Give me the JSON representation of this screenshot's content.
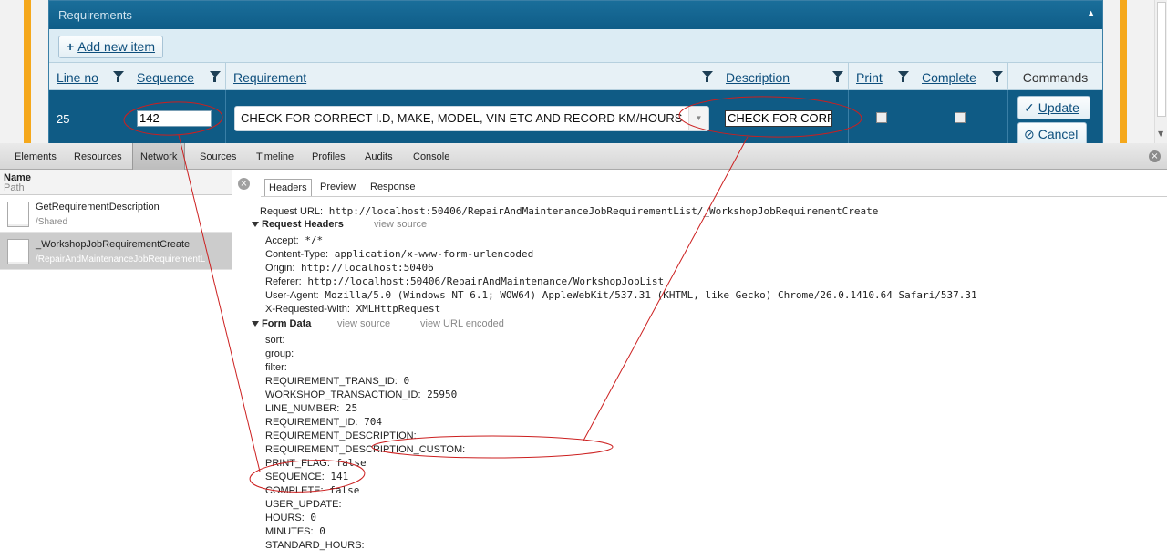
{
  "web": {
    "panel_title": "Requirements",
    "add_button": "Add new item",
    "columns": [
      "Line no",
      "Sequence",
      "Requirement",
      "Description",
      "Print",
      "Complete",
      "Commands"
    ],
    "row": {
      "line_no": "25",
      "sequence": "142",
      "requirement": "CHECK FOR CORRECT I.D, MAKE, MODEL, VIN ETC AND RECORD KM/HOURS",
      "description": "CHECK FOR CORR",
      "print": false,
      "complete": false,
      "update_label": "Update",
      "cancel_label": "Cancel"
    }
  },
  "devtools": {
    "tabs": [
      "Elements",
      "Resources",
      "Network",
      "Sources",
      "Timeline",
      "Profiles",
      "Audits",
      "Console"
    ],
    "active_tab": "Network",
    "list_header": {
      "name": "Name",
      "path": "Path"
    },
    "requests": [
      {
        "name": "GetRequirementDescription",
        "path": "/Shared"
      },
      {
        "name": "_WorkshopJobRequirementCreate",
        "path": "/RepairAndMaintenanceJobRequirementL"
      }
    ],
    "detail_tabs": [
      "Headers",
      "Preview",
      "Response"
    ],
    "request_url_label": "Request URL:",
    "request_url": "http://localhost:50406/RepairAndMaintenanceJobRequirementList/_WorkshopJobRequirementCreate",
    "request_headers_title": "Request Headers",
    "view_source": "view source",
    "view_url_encoded": "view URL encoded",
    "headers": [
      {
        "k": "Accept:",
        "v": "*/*"
      },
      {
        "k": "Content-Type:",
        "v": "application/x-www-form-urlencoded"
      },
      {
        "k": "Origin:",
        "v": "http://localhost:50406"
      },
      {
        "k": "Referer:",
        "v": "http://localhost:50406/RepairAndMaintenance/WorkshopJobList"
      },
      {
        "k": "User-Agent:",
        "v": "Mozilla/5.0 (Windows NT 6.1; WOW64) AppleWebKit/537.31 (KHTML, like Gecko) Chrome/26.0.1410.64 Safari/537.31"
      },
      {
        "k": "X-Requested-With:",
        "v": "XMLHttpRequest"
      }
    ],
    "form_data_title": "Form Data",
    "form_data": [
      {
        "k": "sort:",
        "v": ""
      },
      {
        "k": "group:",
        "v": ""
      },
      {
        "k": "filter:",
        "v": ""
      },
      {
        "k": "REQUIREMENT_TRANS_ID:",
        "v": "0"
      },
      {
        "k": "WORKSHOP_TRANSACTION_ID:",
        "v": "25950"
      },
      {
        "k": "LINE_NUMBER:",
        "v": "25"
      },
      {
        "k": "REQUIREMENT_ID:",
        "v": "704"
      },
      {
        "k": "REQUIREMENT_DESCRIPTION:",
        "v": ""
      },
      {
        "k": "REQUIREMENT_DESCRIPTION_CUSTOM:",
        "v": ""
      },
      {
        "k": "PRINT_FLAG:",
        "v": "false"
      },
      {
        "k": "SEQUENCE:",
        "v": "141"
      },
      {
        "k": "COMPLETE:",
        "v": "false"
      },
      {
        "k": "USER_UPDATE:",
        "v": ""
      },
      {
        "k": "HOURS:",
        "v": "0"
      },
      {
        "k": "MINUTES:",
        "v": "0"
      },
      {
        "k": "STANDARD_HOURS:",
        "v": ""
      }
    ]
  },
  "colors": {
    "grid_header": "#0f5d88",
    "accent": "#f5a81c",
    "annotation": "#cc1f1f"
  }
}
